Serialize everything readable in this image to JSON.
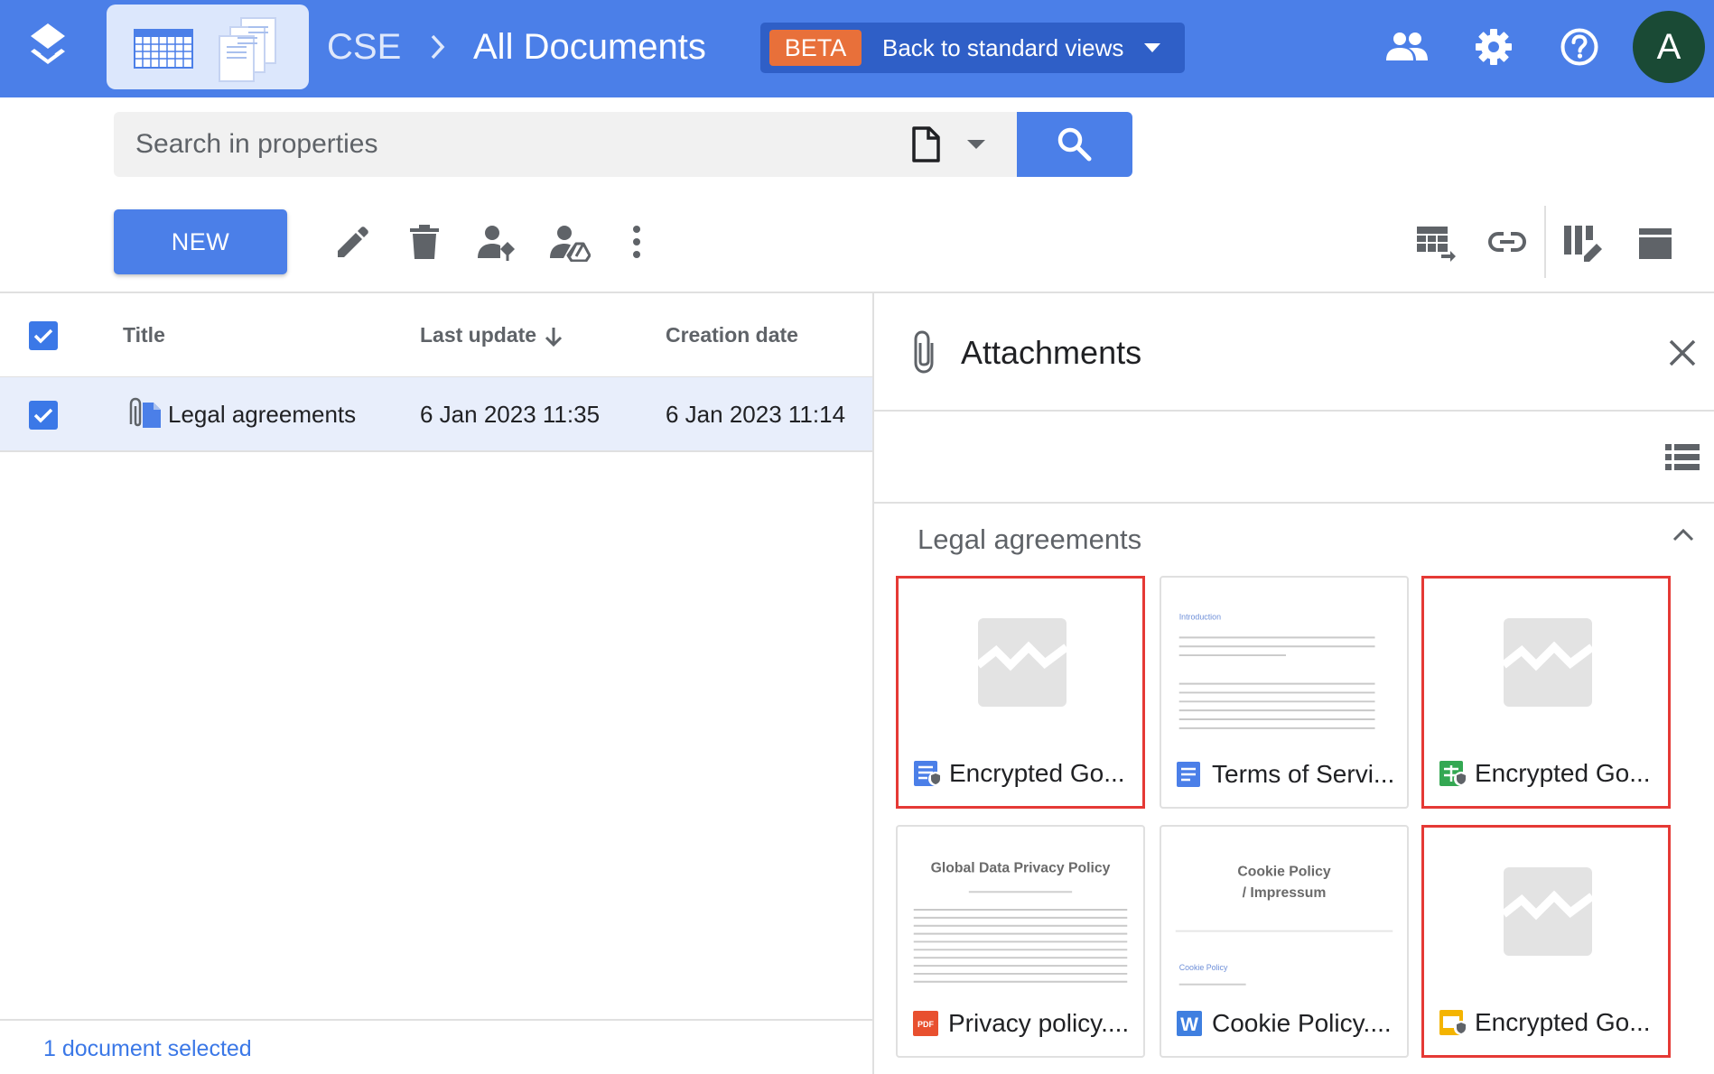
{
  "header": {
    "breadcrumb_root": "CSE",
    "breadcrumb_current": "All Documents",
    "beta_badge": "BETA",
    "beta_link": "Back to standard views",
    "avatar_letter": "A"
  },
  "search": {
    "placeholder": "Search in properties"
  },
  "toolbar": {
    "new_label": "NEW"
  },
  "table": {
    "columns": {
      "title": "Title",
      "last_update": "Last update",
      "creation_date": "Creation date"
    },
    "rows": [
      {
        "title": "Legal agreements",
        "last_update": "6 Jan 2023 11:35",
        "creation_date": "6 Jan 2023 11:14",
        "selected": true
      }
    ],
    "footer": "1 document selected"
  },
  "attachments": {
    "title": "Attachments",
    "section": "Legal agreements",
    "items": [
      {
        "name": "Encrypted Go...",
        "type": "encrypted-docs",
        "highlighted": true
      },
      {
        "name": "Terms of Servi...",
        "type": "docs",
        "highlighted": false
      },
      {
        "name": "Encrypted Go...",
        "type": "encrypted-sheets",
        "highlighted": true
      },
      {
        "name": "Privacy policy....",
        "type": "pdf",
        "highlighted": false
      },
      {
        "name": "Cookie Policy....",
        "type": "word",
        "highlighted": false
      },
      {
        "name": "Encrypted Go...",
        "type": "encrypted-slides",
        "highlighted": true
      }
    ],
    "previews": {
      "terms_heading": "Introduction",
      "privacy_heading": "Global Data Privacy Policy",
      "cookie_heading_line1": "Cookie Policy",
      "cookie_heading_line2": "/ Impressum",
      "cookie_sub": "Cookie Policy"
    }
  },
  "colors": {
    "brand_blue": "#4b7fe8",
    "beta_orange": "#e8703a",
    "highlight_red": "#e53935",
    "avatar_green": "#1a4a35"
  }
}
